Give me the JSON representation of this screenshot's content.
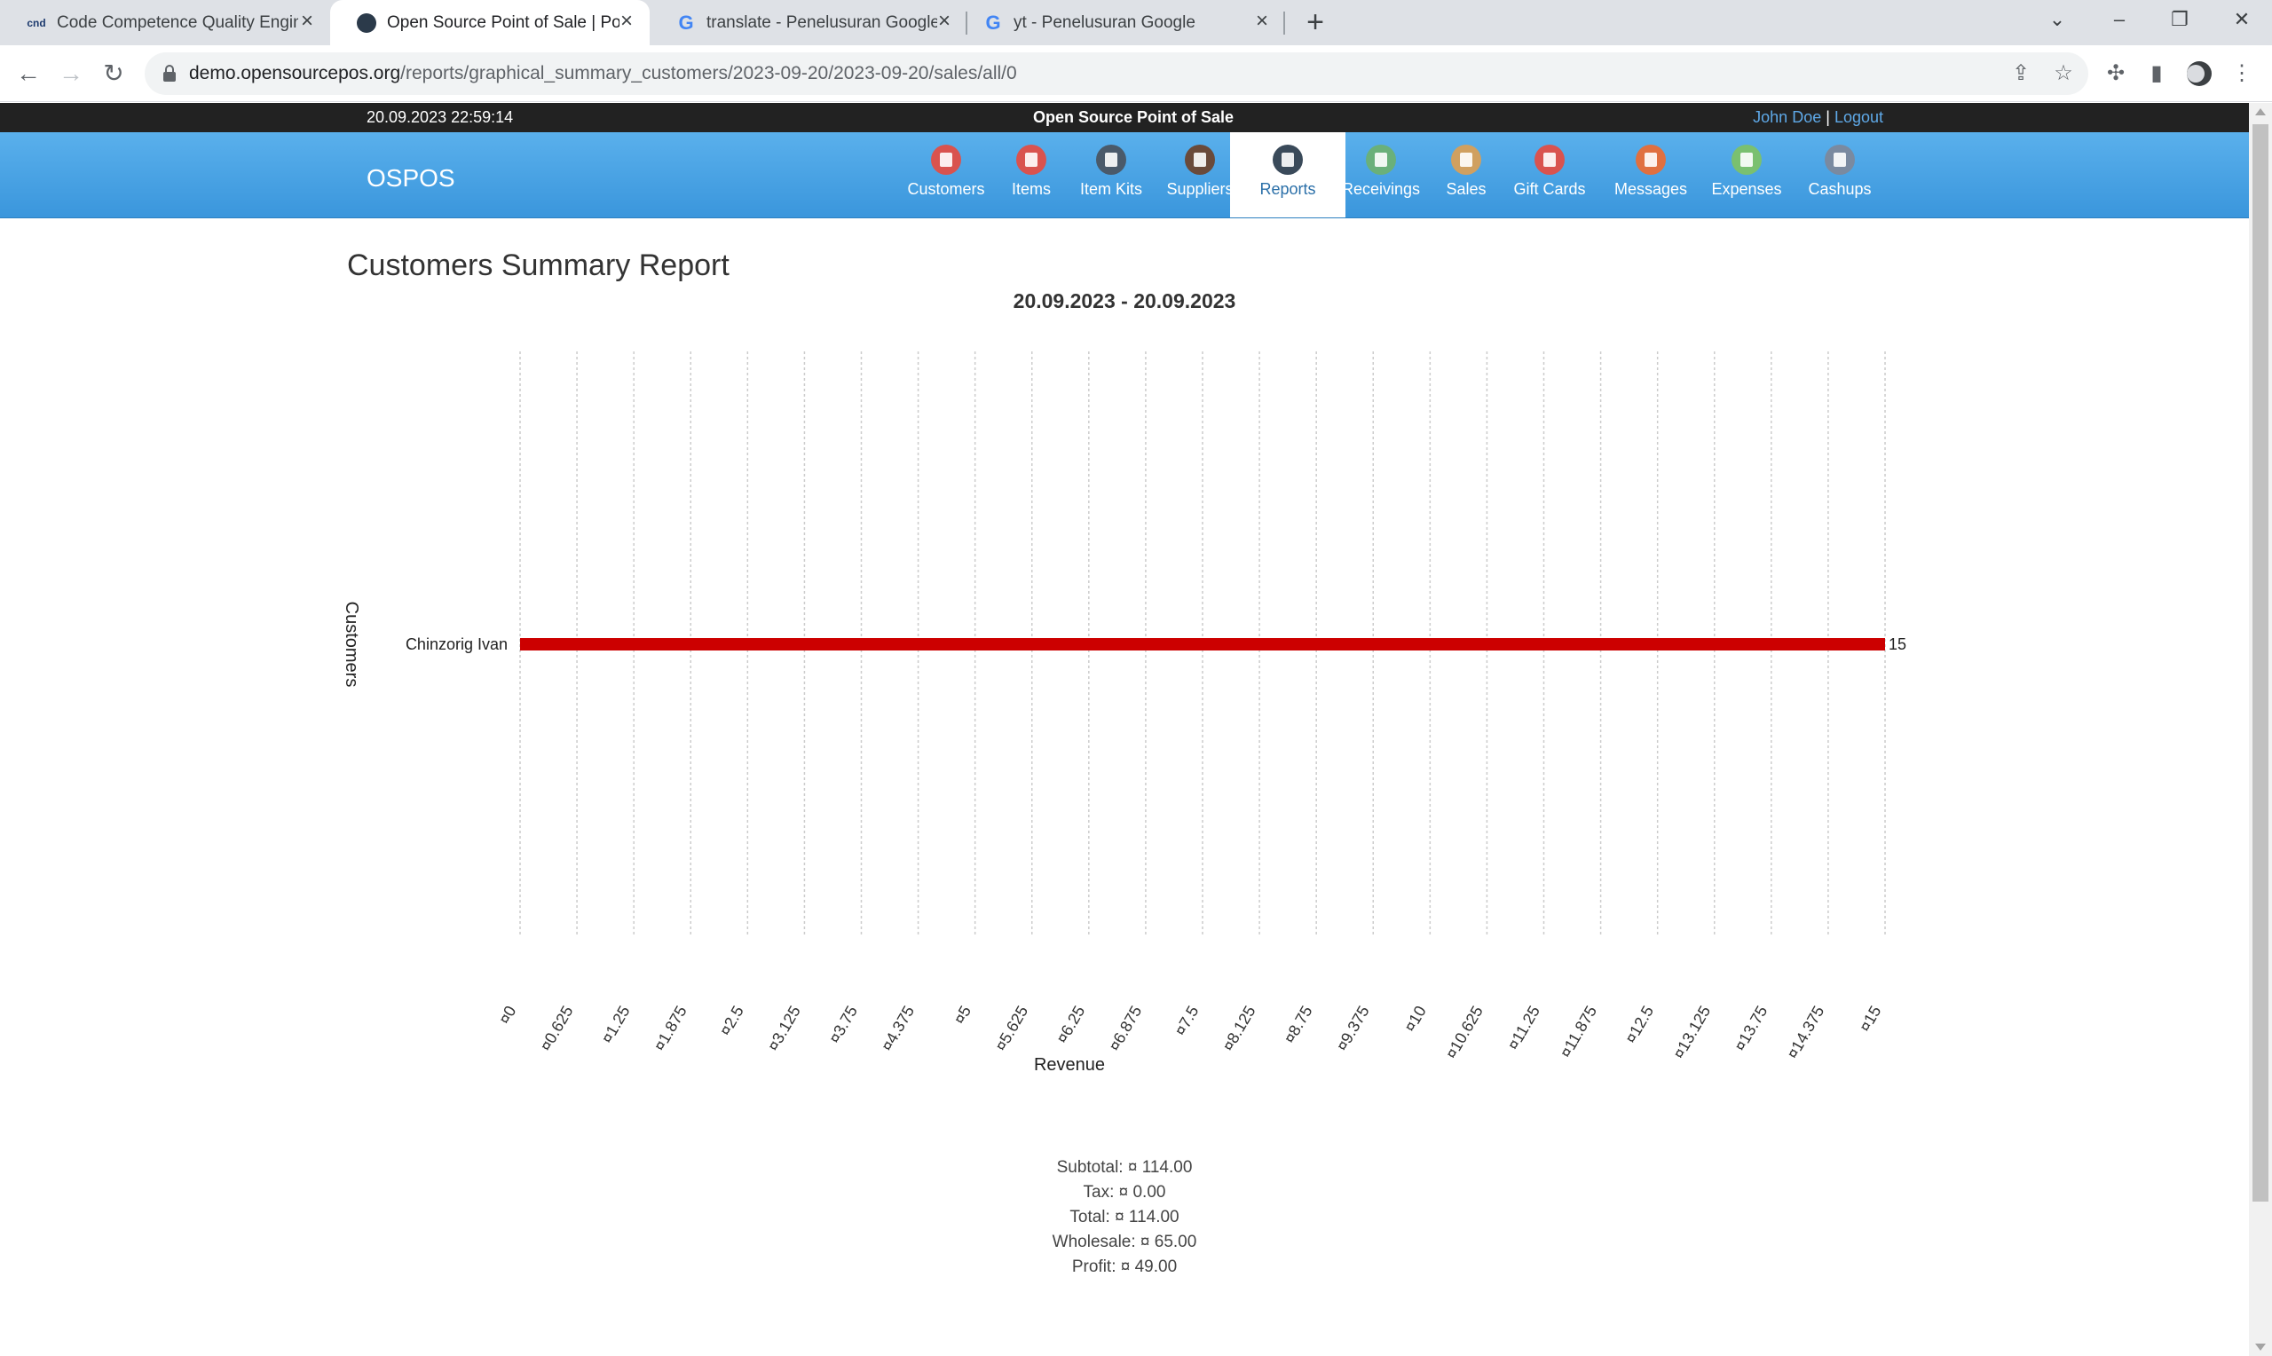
{
  "browser": {
    "tabs": [
      {
        "title": "Code Competence Quality Engine",
        "favicon": "cc"
      },
      {
        "title": "Open Source Point of Sale | Powered by OSPOS",
        "favicon": "ospos",
        "active": true
      },
      {
        "title": "translate - Penelusuran Google",
        "favicon": "g"
      },
      {
        "title": "yt - Penelusuran Google",
        "favicon": "g"
      }
    ],
    "url_host": "demo.opensourcepos.org",
    "url_path": "/reports/graphical_summary_customers/2023-09-20/2023-09-20/sales/all/0"
  },
  "topbar": {
    "datetime": "20.09.2023 22:59:14",
    "site_name": "Open Source Point of Sale",
    "user": "John Doe",
    "separator": "|",
    "logout": "Logout"
  },
  "navbar": {
    "brand": "OSPOS",
    "items": [
      {
        "label": "Customers",
        "icon": "customers-icon",
        "color": "#d9534f"
      },
      {
        "label": "Items",
        "icon": "items-icon",
        "color": "#d9534f"
      },
      {
        "label": "Item Kits",
        "icon": "item-kits-icon",
        "color": "#4a5a6a"
      },
      {
        "label": "Suppliers",
        "icon": "suppliers-icon",
        "color": "#6a4a3a"
      },
      {
        "label": "Reports",
        "icon": "reports-icon",
        "color": "#3a4a5a",
        "active": true
      },
      {
        "label": "Receivings",
        "icon": "receivings-icon",
        "color": "#6ab07a"
      },
      {
        "label": "Sales",
        "icon": "sales-icon",
        "color": "#d0a060"
      },
      {
        "label": "Gift Cards",
        "icon": "gift-cards-icon",
        "color": "#d9534f"
      },
      {
        "label": "Messages",
        "icon": "messages-icon",
        "color": "#e07040"
      },
      {
        "label": "Expenses",
        "icon": "expenses-icon",
        "color": "#7ac070"
      },
      {
        "label": "Cashups",
        "icon": "cashups-icon",
        "color": "#7a8aa0"
      }
    ]
  },
  "report": {
    "title": "Customers Summary Report",
    "subtitle": "20.09.2023 - 20.09.2023"
  },
  "chart_data": {
    "type": "bar",
    "orientation": "horizontal",
    "categories": [
      "Chinzorig Ivan"
    ],
    "values": [
      15
    ],
    "bar_color": "#cc0000",
    "ylabel": "Customers",
    "xlabel": "Revenue",
    "xlim": [
      0,
      15
    ],
    "xticks": [
      "¤0",
      "¤0.625",
      "¤1.25",
      "¤1.875",
      "¤2.5",
      "¤3.125",
      "¤3.75",
      "¤4.375",
      "¤5",
      "¤5.625",
      "¤6.25",
      "¤6.875",
      "¤7.5",
      "¤8.125",
      "¤8.75",
      "¤9.375",
      "¤10",
      "¤10.625",
      "¤11.25",
      "¤11.875",
      "¤12.5",
      "¤13.125",
      "¤13.75",
      "¤14.375",
      "¤15"
    ],
    "grid": true,
    "value_labels": [
      "15"
    ]
  },
  "summary": [
    "Subtotal: ¤ 114.00",
    "Tax: ¤ 0.00",
    "Total: ¤ 114.00",
    "Wholesale: ¤ 65.00",
    "Profit: ¤ 49.00"
  ]
}
